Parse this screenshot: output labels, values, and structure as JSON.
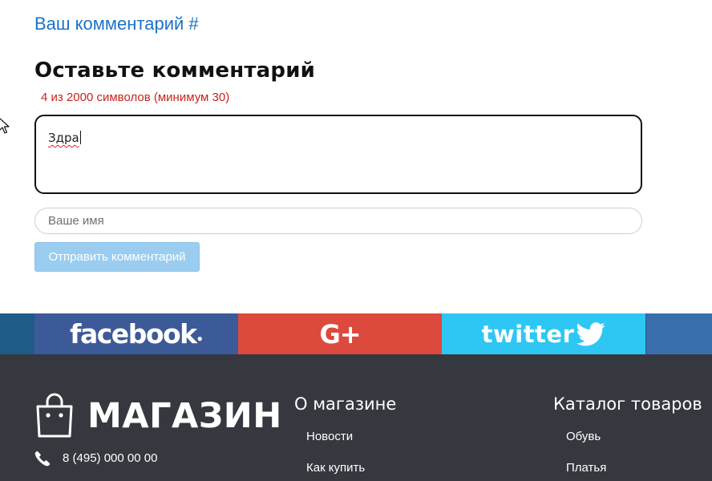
{
  "comments": {
    "reply_link": "Ваш комментарий #"
  },
  "comment_form": {
    "title": "Оставьте комментарий",
    "char_counter": "4 из 2000 символов (минимум 30)",
    "comment_value": "Здра",
    "name_placeholder": "Ваше имя",
    "submit_label": "Отправить комментарий"
  },
  "social": {
    "facebook_label": "facebook",
    "googleplus_label": "G+",
    "twitter_label": "twitter",
    "colors": {
      "facebook": "#3d5a98",
      "googleplus": "#dc4a3d",
      "twitter": "#2ec7f4"
    }
  },
  "footer": {
    "logo_text": "МАГАЗИН",
    "logo_icon": "shopping-bag-icon",
    "phone_icon": "phone-icon",
    "phone": "8 (495) 000 00 00",
    "columns": [
      {
        "title": "О магазине",
        "links": [
          "Новости",
          "Как купить"
        ]
      },
      {
        "title": "Каталог товаров",
        "links": [
          "Обувь",
          "Платья"
        ]
      }
    ],
    "background": "#35383e"
  },
  "accent_color": "#1a73c8"
}
